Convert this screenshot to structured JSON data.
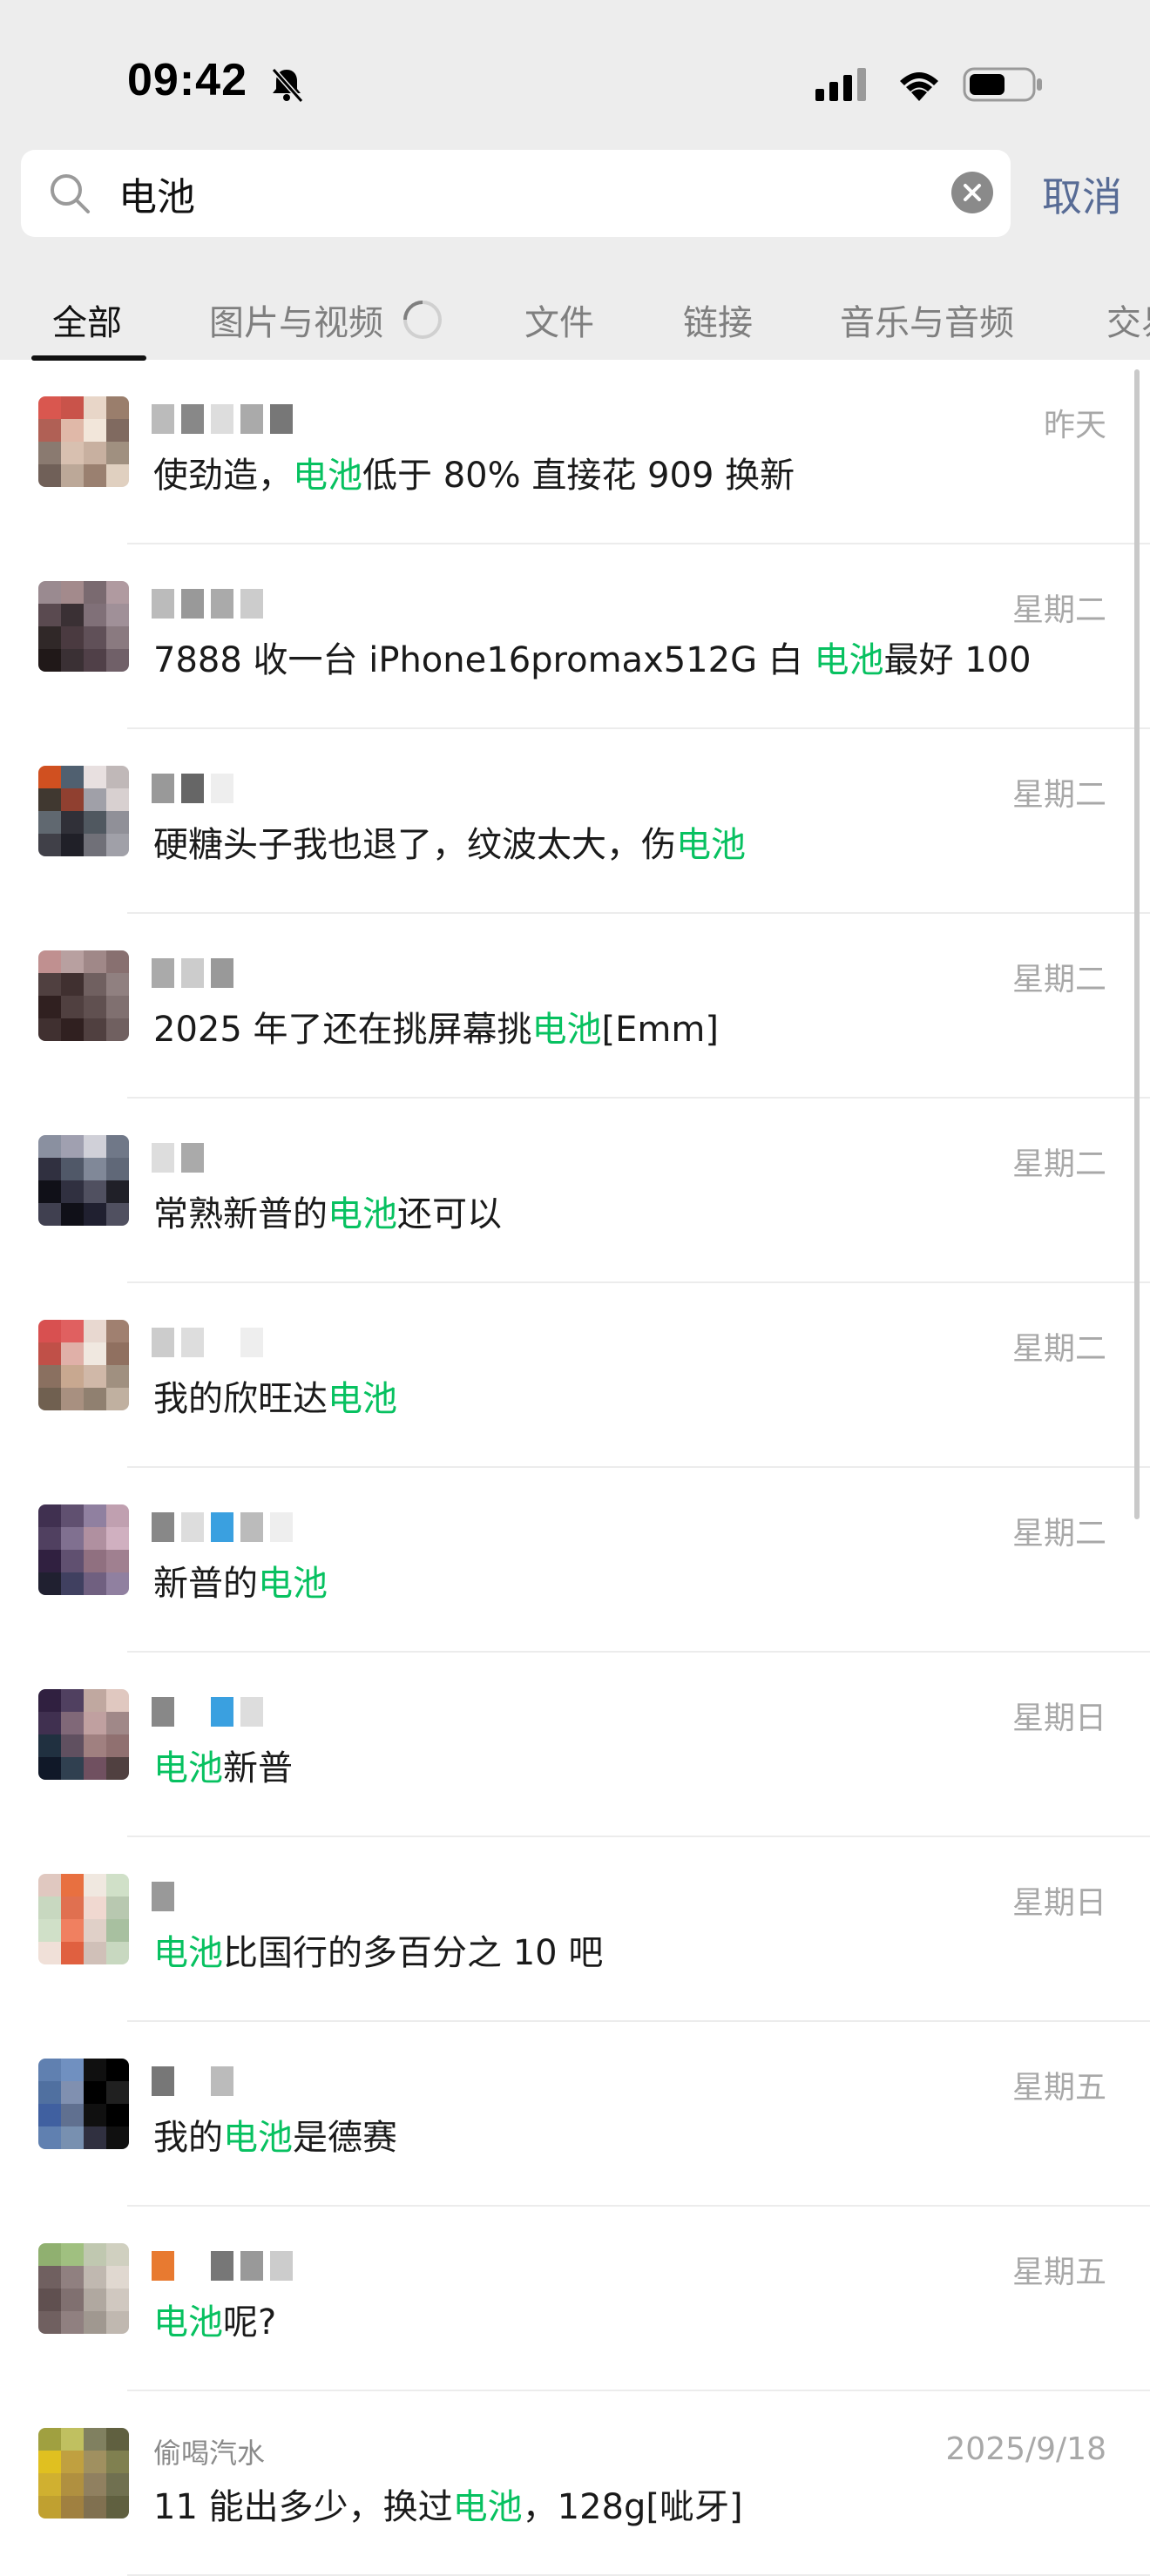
{
  "status_bar": {
    "time": "09:42"
  },
  "search": {
    "query": "电池",
    "cancel_label": "取消"
  },
  "tabs": [
    {
      "label": "全部",
      "active": true
    },
    {
      "label": "图片与视频",
      "active": false
    },
    {
      "label": "文件",
      "active": false
    },
    {
      "label": "链接",
      "active": false
    },
    {
      "label": "音乐与音频",
      "active": false
    },
    {
      "label": "交易",
      "active": false
    }
  ],
  "colors": {
    "highlight": "#07c160",
    "link": "#576b95",
    "header_bg": "#ededed"
  },
  "results": [
    {
      "date": "昨天",
      "segments": [
        {
          "t": "使劲造，"
        },
        {
          "t": "电池",
          "hl": true
        },
        {
          "t": "低于 80% 直接花 909 换新"
        }
      ]
    },
    {
      "date": "星期二",
      "segments": [
        {
          "t": "7888 收一台 iPhone16promax512G 白 "
        },
        {
          "t": "电池",
          "hl": true
        },
        {
          "t": "最好 100"
        }
      ]
    },
    {
      "date": "星期二",
      "segments": [
        {
          "t": "硬糖头子我也退了，纹波太大，伤"
        },
        {
          "t": "电池",
          "hl": true
        }
      ]
    },
    {
      "date": "星期二",
      "segments": [
        {
          "t": "2025 年了还在挑屏幕挑"
        },
        {
          "t": "电池",
          "hl": true
        },
        {
          "t": "[Emm]"
        }
      ]
    },
    {
      "date": "星期二",
      "segments": [
        {
          "t": "常熟新普的"
        },
        {
          "t": "电池",
          "hl": true
        },
        {
          "t": "还可以"
        }
      ]
    },
    {
      "date": "星期二",
      "segments": [
        {
          "t": "我的欣旺达"
        },
        {
          "t": "电池",
          "hl": true
        }
      ]
    },
    {
      "date": "星期二",
      "segments": [
        {
          "t": "新普的"
        },
        {
          "t": "电池",
          "hl": true
        }
      ]
    },
    {
      "date": "星期日",
      "segments": [
        {
          "t": "电池",
          "hl": true
        },
        {
          "t": "新普"
        }
      ]
    },
    {
      "date": "星期日",
      "segments": [
        {
          "t": "电池",
          "hl": true
        },
        {
          "t": "比国行的多百分之 10 吧"
        }
      ]
    },
    {
      "date": "星期五",
      "segments": [
        {
          "t": "我的"
        },
        {
          "t": "电池",
          "hl": true
        },
        {
          "t": "是德赛"
        }
      ]
    },
    {
      "date": "星期五",
      "segments": [
        {
          "t": "电池",
          "hl": true
        },
        {
          "t": "呢?"
        }
      ]
    },
    {
      "name": "偷喝汽水",
      "date": "2025/9/18",
      "segments": [
        {
          "t": "11 能出多少，换过"
        },
        {
          "t": "电池",
          "hl": true
        },
        {
          "t": "，128g[呲牙]"
        }
      ]
    }
  ]
}
